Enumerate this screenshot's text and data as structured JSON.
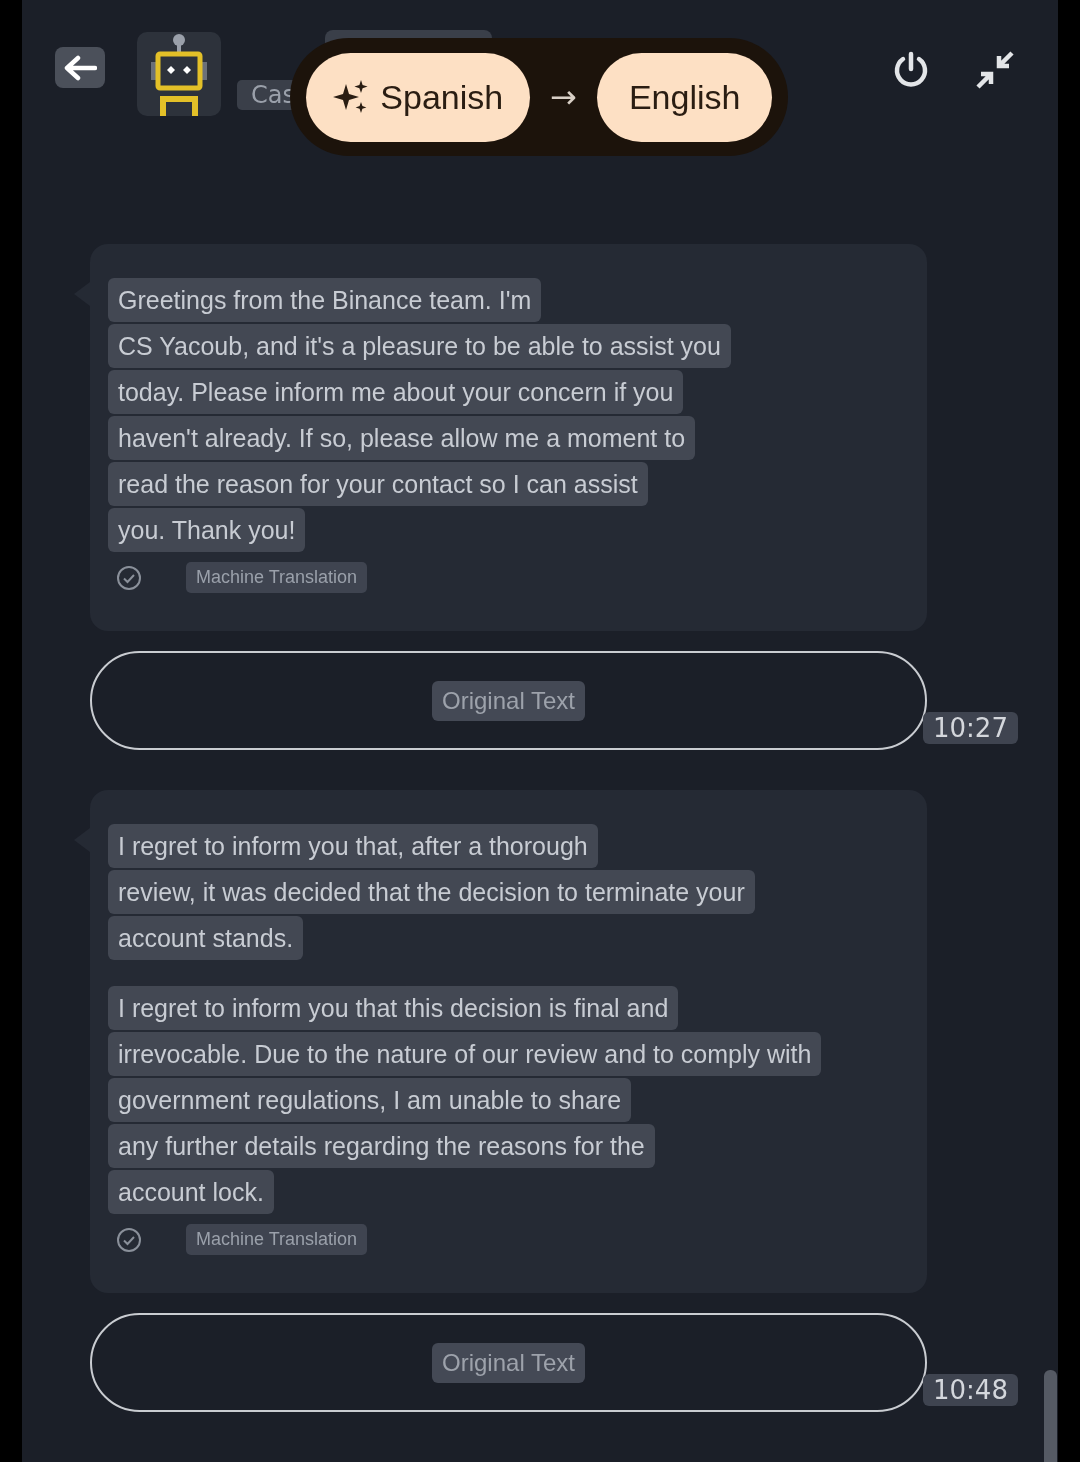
{
  "header": {
    "name_label": "Cas",
    "translation": {
      "source": "Spanish",
      "arrow": "→",
      "target": "English"
    }
  },
  "messages": [
    {
      "paragraphs": [
        [
          "Greetings from the Binance team. I'm",
          "CS Yacoub, and it's a pleasure to be able to assist you",
          "today. Please inform me about your concern if you",
          "haven't already. If so, please allow me a moment to",
          "read the reason for your contact so I can assist",
          "you. Thank you!"
        ]
      ],
      "verified": true,
      "badge": "Machine Translation",
      "original_button": "Original Text",
      "time": "10:27"
    },
    {
      "paragraphs": [
        [
          "I regret to inform you that, after a thorough",
          "review, it was decided that the decision to terminate your",
          "account stands."
        ],
        [
          "I regret to inform you that this decision is final and",
          "irrevocable. Due to the nature of our review and to comply with",
          "government regulations, I am unable to share",
          "any further details regarding the reasons for the",
          "account lock."
        ]
      ],
      "verified": true,
      "badge": "Machine Translation",
      "original_button": "Original Text",
      "time": "10:48"
    }
  ]
}
